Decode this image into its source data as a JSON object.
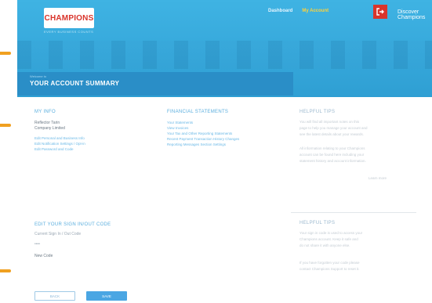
{
  "header": {
    "logo": "CHAMPIONS",
    "logo_tagline": "EVERY BUSINESS COUNTS",
    "nav": [
      "Dashboard",
      "My Account"
    ],
    "logout_icon": "logout-icon",
    "discover": "Discover Champions",
    "title_sub": "Welcome to",
    "title": "YOUR ACCOUNT SUMMARY"
  },
  "details": {
    "heading": "MY INFO",
    "name": "Reflector Tarin",
    "company": "Company Limited",
    "links": [
      "Edit Personal and Business Info",
      "Edit Notification Settings / Opt-in",
      "Edit Password and Code"
    ]
  },
  "statements": {
    "heading": "FINANCIAL STATEMENTS",
    "links": [
      "Your Statements",
      "View Invoices",
      "Your Tax and Other Reporting Statements",
      "Recent Payment Transaction History Changes",
      "Reporting Messages Section Settings"
    ]
  },
  "helpful_tips": {
    "heading": "HELPFUL TIPS",
    "lines": [
      "You will find all important notes on this",
      "page to help you manage your account and",
      "see the latest details about your rewards.",
      "",
      "All information relating to your Champions",
      "account can be found here including your",
      "statement history and account information.",
      "",
      "Learn more"
    ]
  },
  "sign_in": {
    "heading": "EDIT YOUR SIGN IN/OUT CODE",
    "field1_label": "Current Sign In / Out Code",
    "field1_value": "••••",
    "field2_label": "New Code"
  },
  "helpful_tips2": {
    "heading": "HELPFUL TIPS",
    "lines": [
      "Your sign in code is used to access your",
      "Champions account. Keep it safe and",
      "do not share it with anyone else.",
      "",
      "If you have forgotten your code please",
      "contact Champions Support to reset it."
    ]
  },
  "buttons": {
    "back": "BACK",
    "save": "SAVE"
  },
  "colors": {
    "header": "#3fb3e3",
    "accent": "#d9342b",
    "link": "#6ab8e6",
    "save": "#4aa6e3"
  }
}
